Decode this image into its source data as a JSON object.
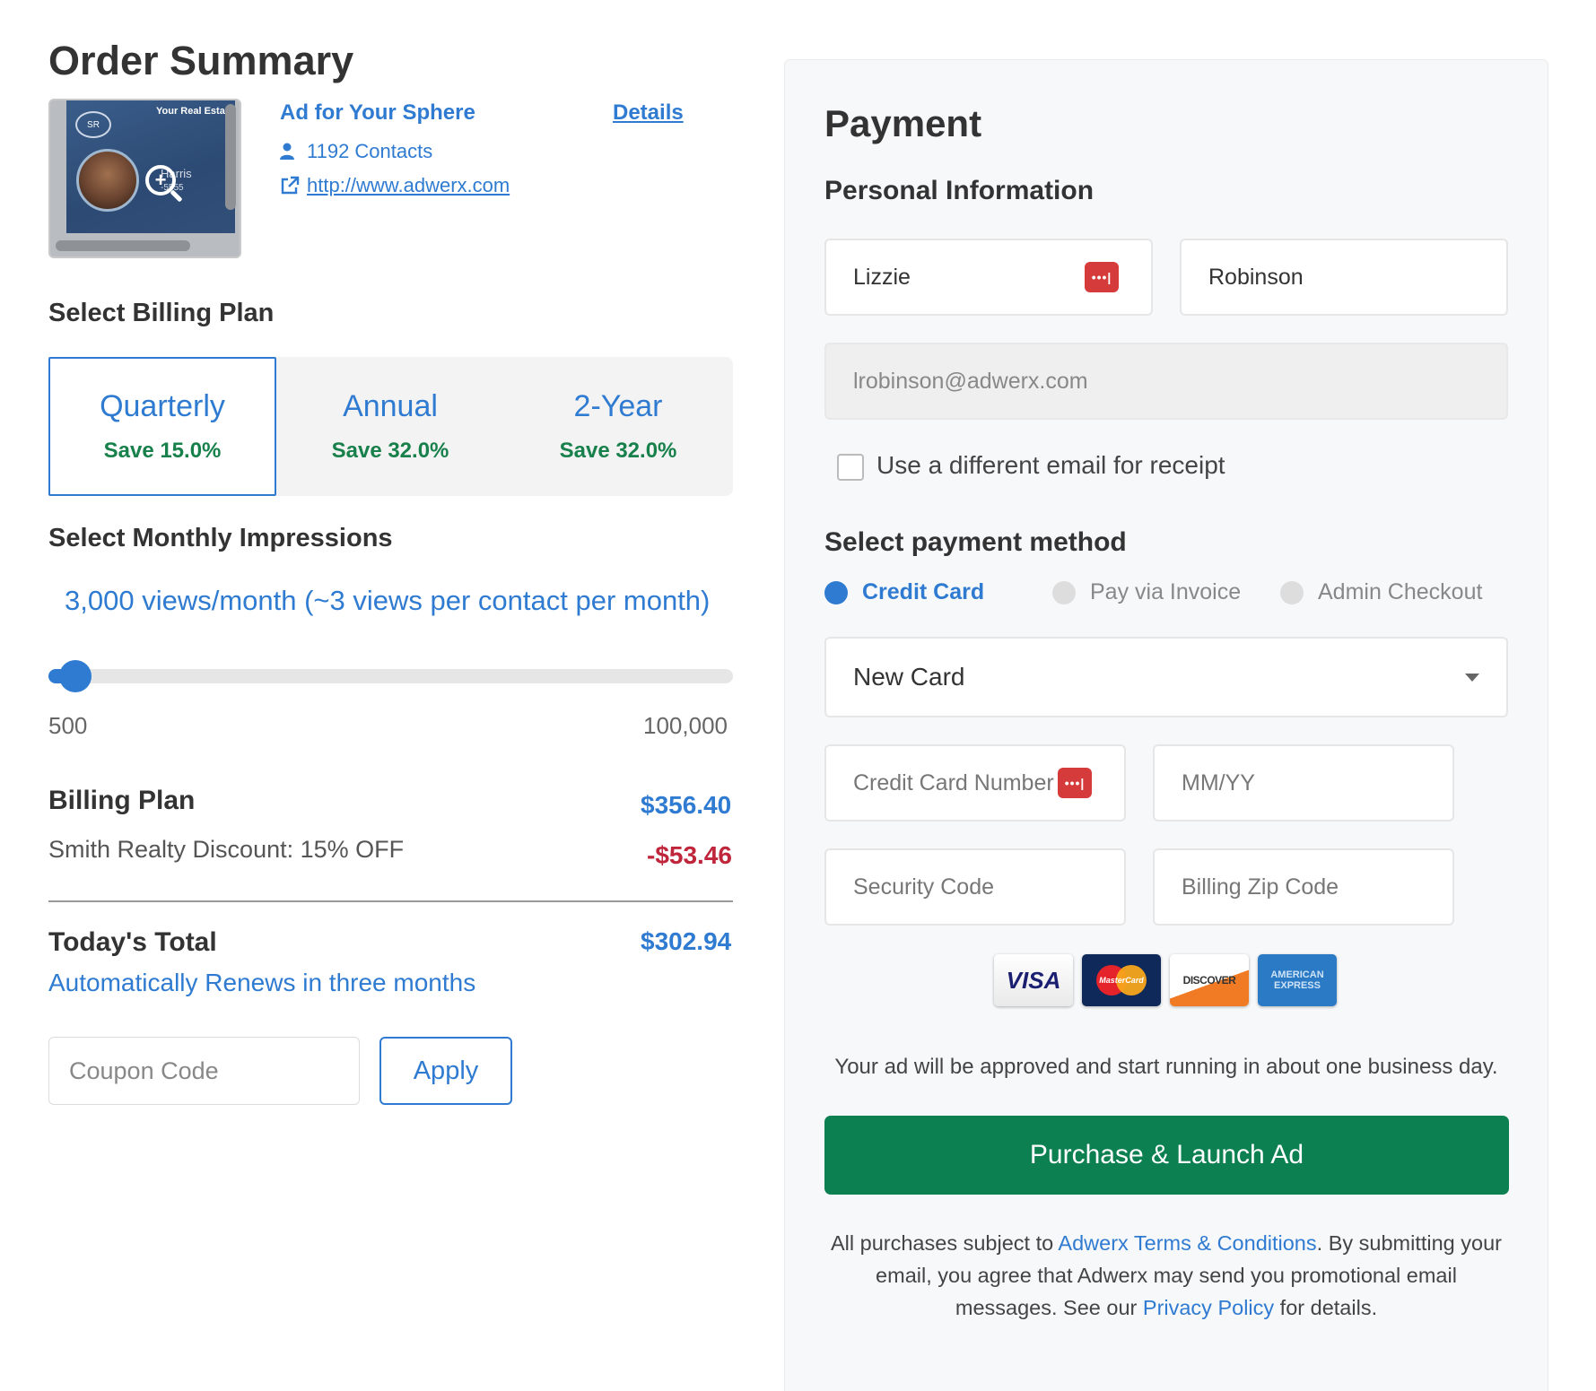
{
  "order": {
    "heading": "Order Summary",
    "preview": {
      "badge": "SR",
      "title": "Your Real Estate",
      "name": "Harris",
      "number": "-5555"
    },
    "ad_title": "Ad for Your Sphere",
    "details_link": "Details",
    "contacts": "1192 Contacts",
    "url": "http://www.adwerx.com"
  },
  "billing": {
    "heading": "Select Billing Plan",
    "plans": [
      {
        "name": "Quarterly",
        "save": "Save 15.0%",
        "selected": true
      },
      {
        "name": "Annual",
        "save": "Save 32.0%",
        "selected": false
      },
      {
        "name": "2-Year",
        "save": "Save 32.0%",
        "selected": false
      }
    ]
  },
  "impressions": {
    "heading": "Select Monthly Impressions",
    "views_text": "3,000 views/month (~3 views per contact per month)",
    "min_label": "500",
    "max_label": "100,000",
    "value": 3000
  },
  "summary": {
    "plan_label": "Billing Plan",
    "plan_value": "$356.40",
    "discount_label": "Smith Realty Discount: 15% OFF",
    "discount_value": "-$53.46",
    "total_label": "Today's Total",
    "total_value": "$302.94",
    "renew_text": "Automatically Renews in three months"
  },
  "coupon": {
    "placeholder": "Coupon Code",
    "apply_label": "Apply"
  },
  "payment": {
    "heading": "Payment",
    "personal_heading": "Personal Information",
    "first_name": "Lizzie",
    "last_name": "Robinson",
    "email": "lrobinson@adwerx.com",
    "password_badge": "•••|",
    "different_email_label": "Use a different email for receipt",
    "method_heading": "Select payment method",
    "methods": [
      {
        "label": "Credit Card",
        "selected": true
      },
      {
        "label": "Pay via Invoice",
        "selected": false
      },
      {
        "label": "Admin Checkout",
        "selected": false
      }
    ],
    "card_select": "New Card",
    "placeholders": {
      "card_number": "Credit Card Number",
      "expiry": "MM/YY",
      "security": "Security Code",
      "zip": "Billing Zip Code"
    },
    "card_logos": {
      "visa": "VISA",
      "mastercard": "MasterCard",
      "discover": "DISCOVER",
      "amex_line1": "AMERICAN",
      "amex_line2": "EXPRESS"
    },
    "approval_text": "Your ad will be approved and start running in about one business day.",
    "purchase_label": "Purchase & Launch Ad",
    "legal": {
      "part1": "All purchases subject to ",
      "terms_link": "Adwerx Terms & Conditions",
      "part2": ". By submitting your email, you agree that Adwerx may send you promotional email messages. See our ",
      "privacy_link": "Privacy Policy",
      "part3": " for details."
    }
  },
  "colors": {
    "accent": "#2f7bd1",
    "save_green": "#17804b",
    "discount_red": "#c0263b",
    "purchase_green": "#0c8050"
  }
}
